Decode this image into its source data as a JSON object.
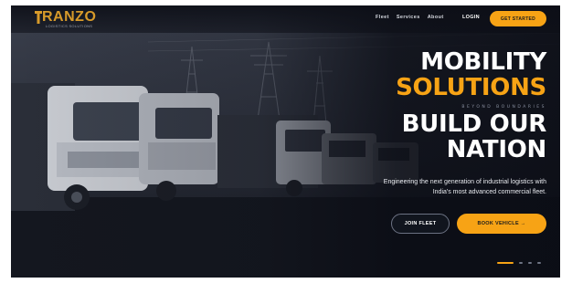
{
  "brand": {
    "logo_text": "RANZO",
    "tagline": "LOGISTICS SOLUTIONS"
  },
  "nav": {
    "links": [
      "Fleet",
      "Services",
      "About"
    ],
    "login_label": "LOGIN",
    "cta_label": "GET STARTED"
  },
  "hero": {
    "line1": "MOBILITY",
    "line2": "SOLUTIONS",
    "sub_tag": "BEYOND BOUNDARIES",
    "line3": "BUILD OUR",
    "line4": "NATION",
    "description": "Engineering the next generation of industrial logistics with India's most advanced commercial fleet.",
    "join_label": "JOIN FLEET",
    "book_label": "BOOK VEHICLE →"
  },
  "carousel": {
    "slide_count": 4,
    "active_index": 0
  },
  "colors": {
    "accent": "#f7a315",
    "background": "#171b26",
    "text": "#ffffff"
  },
  "icons": [
    "truck-logo-icon",
    "arrow-right-icon"
  ]
}
